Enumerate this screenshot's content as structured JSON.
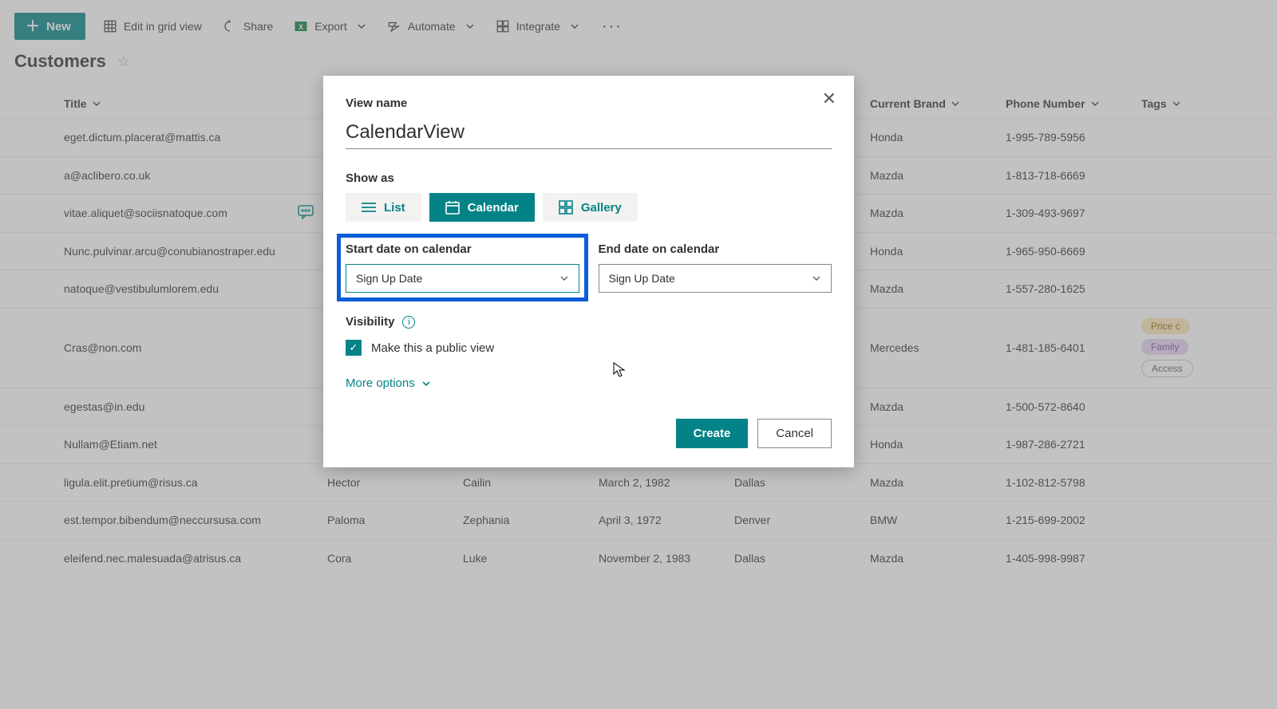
{
  "toolbar": {
    "new_label": "New",
    "edit_grid_label": "Edit in grid view",
    "share_label": "Share",
    "export_label": "Export",
    "automate_label": "Automate",
    "integrate_label": "Integrate"
  },
  "list": {
    "title": "Customers"
  },
  "columns": {
    "title": "Title",
    "first": "",
    "last": "",
    "dob": "",
    "city": "",
    "brand": "Current Brand",
    "phone": "Phone Number",
    "tags": "Tags"
  },
  "rows": [
    {
      "email": "eget.dictum.placerat@mattis.ca",
      "first": "",
      "last": "",
      "dob": "",
      "city": "",
      "brand": "Honda",
      "phone": "1-995-789-5956",
      "tags": []
    },
    {
      "email": "a@aclibero.co.uk",
      "first": "",
      "last": "",
      "dob": "",
      "city": "",
      "brand": "Mazda",
      "phone": "1-813-718-6669",
      "tags": []
    },
    {
      "email": "vitae.aliquet@sociisnatoque.com",
      "first": "",
      "last": "",
      "dob": "",
      "city": "",
      "brand": "Mazda",
      "phone": "1-309-493-9697",
      "tags": [],
      "has_comment": true
    },
    {
      "email": "Nunc.pulvinar.arcu@conubianostraper.edu",
      "first": "",
      "last": "",
      "dob": "",
      "city": "",
      "brand": "Honda",
      "phone": "1-965-950-6669",
      "tags": []
    },
    {
      "email": "natoque@vestibulumlorem.edu",
      "first": "",
      "last": "",
      "dob": "",
      "city": "",
      "brand": "Mazda",
      "phone": "1-557-280-1625",
      "tags": []
    },
    {
      "email": "Cras@non.com",
      "first": "",
      "last": "",
      "dob": "",
      "city": "",
      "brand": "Mercedes",
      "phone": "1-481-185-6401",
      "tags": [
        "Price c",
        "Family",
        "Access"
      ]
    },
    {
      "email": "egestas@in.edu",
      "first": "",
      "last": "",
      "dob": "",
      "city": "",
      "brand": "Mazda",
      "phone": "1-500-572-8640",
      "tags": []
    },
    {
      "email": "Nullam@Etiam.net",
      "first": "",
      "last": "",
      "dob": "",
      "city": "",
      "brand": "Honda",
      "phone": "1-987-286-2721",
      "tags": []
    },
    {
      "email": "ligula.elit.pretium@risus.ca",
      "first": "Hector",
      "last": "Cailin",
      "dob": "March 2, 1982",
      "city": "Dallas",
      "brand": "Mazda",
      "phone": "1-102-812-5798",
      "tags": []
    },
    {
      "email": "est.tempor.bibendum@neccursusa.com",
      "first": "Paloma",
      "last": "Zephania",
      "dob": "April 3, 1972",
      "city": "Denver",
      "brand": "BMW",
      "phone": "1-215-699-2002",
      "tags": []
    },
    {
      "email": "eleifend.nec.malesuada@atrisus.ca",
      "first": "Cora",
      "last": "Luke",
      "dob": "November 2, 1983",
      "city": "Dallas",
      "brand": "Mazda",
      "phone": "1-405-998-9987",
      "tags": []
    }
  ],
  "modal": {
    "view_name_label": "View name",
    "view_name_value": "CalendarView",
    "show_as_label": "Show as",
    "show_as_list": "List",
    "show_as_calendar": "Calendar",
    "show_as_gallery": "Gallery",
    "start_date_label": "Start date on calendar",
    "start_date_value": "Sign Up Date",
    "end_date_label": "End date on calendar",
    "end_date_value": "Sign Up Date",
    "visibility_label": "Visibility",
    "public_view_label": "Make this a public view",
    "more_options_label": "More options",
    "create_label": "Create",
    "cancel_label": "Cancel"
  },
  "tag_classes": [
    "yellow",
    "purple",
    "outline"
  ]
}
